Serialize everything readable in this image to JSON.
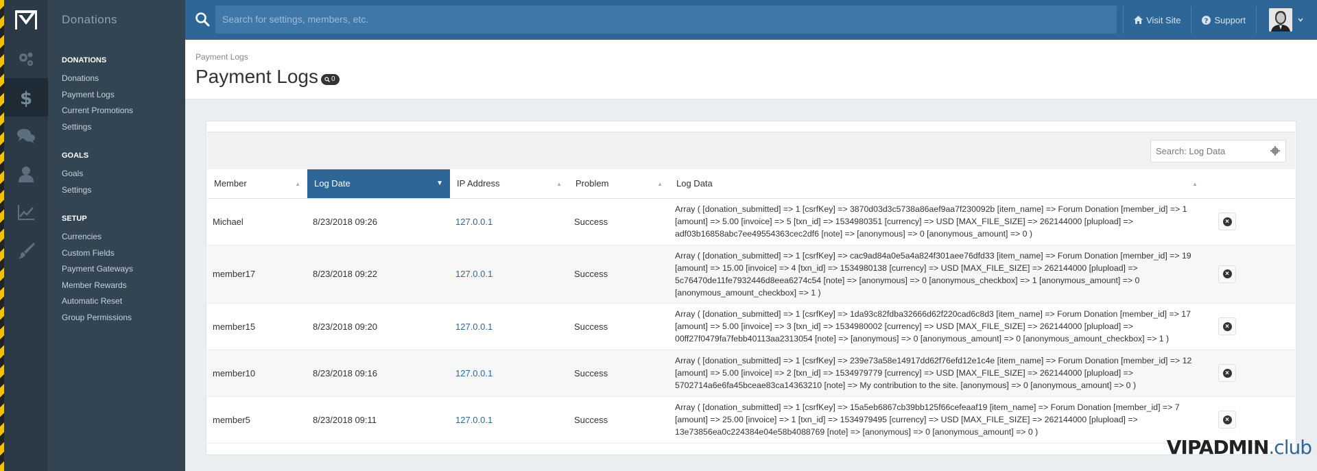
{
  "app": {
    "section_title": "Donations"
  },
  "search": {
    "placeholder": "Search for settings, members, etc."
  },
  "top_links": [
    {
      "label": "Visit Site",
      "icon": "home-icon"
    },
    {
      "label": "Support",
      "icon": "question-circle-icon"
    }
  ],
  "rail": [
    {
      "icon": "gears-icon",
      "active": false
    },
    {
      "icon": "dollar-icon",
      "active": true
    },
    {
      "icon": "chat-bubbles-icon",
      "active": false
    },
    {
      "icon": "user-icon",
      "active": false
    },
    {
      "icon": "line-chart-icon",
      "active": false
    },
    {
      "icon": "paintbrush-icon",
      "active": false
    }
  ],
  "menu": {
    "donations": {
      "heading": "Donations",
      "items": [
        "Donations",
        "Payment Logs",
        "Current Promotions",
        "Settings"
      ]
    },
    "goals": {
      "heading": "Goals",
      "items": [
        "Goals",
        "Settings"
      ]
    },
    "setup": {
      "heading": "Setup",
      "items": [
        "Currencies",
        "Custom Fields",
        "Payment Gateways",
        "Member Rewards",
        "Automatic Reset",
        "Group Permissions"
      ]
    }
  },
  "page": {
    "breadcrumb": "Payment Logs",
    "title": "Payment Logs",
    "badge_count": "0"
  },
  "filter": {
    "placeholder": "Search: Log Data"
  },
  "table": {
    "columns": [
      "Member",
      "Log Date",
      "IP Address",
      "Problem",
      "Log Data"
    ],
    "sorted_column": "Log Date",
    "rows": [
      {
        "member": "Michael",
        "date": "8/23/2018 09:26",
        "ip": "127.0.0.1",
        "problem": "Success",
        "data": "Array ( [donation_submitted] => 1 [csrfKey] => 3870d03d3c5738a86aef9aa7f230092b [item_name] => Forum Donation [member_id] => 1 [amount] => 5.00 [invoice] => 5 [txn_id] => 1534980351 [currency] => USD [MAX_FILE_SIZE] => 262144000 [plupload] => adf03b16858abc7ee49554363cec2df6 [note] => [anonymous] => 0 [anonymous_amount] => 0 )"
      },
      {
        "member": "member17",
        "date": "8/23/2018 09:22",
        "ip": "127.0.0.1",
        "problem": "Success",
        "data": "Array ( [donation_submitted] => 1 [csrfKey] => cac9ad84a0e5a4a824f301aee76dfd33 [item_name] => Forum Donation [member_id] => 19 [amount] => 15.00 [invoice] => 4 [txn_id] => 1534980138 [currency] => USD [MAX_FILE_SIZE] => 262144000 [plupload] => 5c76470de11fe7932446d8eea6274c54 [note] => [anonymous] => 0 [anonymous_checkbox] => 1 [anonymous_amount] => 0 [anonymous_amount_checkbox] => 1 )"
      },
      {
        "member": "member15",
        "date": "8/23/2018 09:20",
        "ip": "127.0.0.1",
        "problem": "Success",
        "data": "Array ( [donation_submitted] => 1 [csrfKey] => 1da93c82fdba32666d62f220cad6c8d3 [item_name] => Forum Donation [member_id] => 17 [amount] => 5.00 [invoice] => 3 [txn_id] => 1534980002 [currency] => USD [MAX_FILE_SIZE] => 262144000 [plupload] => 00ff27f0479fa7febb40113aa2313054 [note] => [anonymous] => 0 [anonymous_amount] => 0 [anonymous_amount_checkbox] => 1 )"
      },
      {
        "member": "member10",
        "date": "8/23/2018 09:16",
        "ip": "127.0.0.1",
        "problem": "Success",
        "data": "Array ( [donation_submitted] => 1 [csrfKey] => 239e73a58e14917dd62f76efd12e1c4e [item_name] => Forum Donation [member_id] => 12 [amount] => 5.00 [invoice] => 2 [txn_id] => 1534979779 [currency] => USD [MAX_FILE_SIZE] => 262144000 [plupload] => 5702714a6e6fa45bceae83ca14363210 [note] => My contribution to the site. [anonymous] => 0 [anonymous_amount] => 0 )"
      },
      {
        "member": "member5",
        "date": "8/23/2018 09:11",
        "ip": "127.0.0.1",
        "problem": "Success",
        "data": "Array ( [donation_submitted] => 1 [csrfKey] => 15a5eb6867cb39bb125f66cefeaaf19 [item_name] => Forum Donation [member_id] => 7 [amount] => 25.00 [invoice] => 1 [txn_id] => 1534979495 [currency] => USD [MAX_FILE_SIZE] => 262144000 [plupload] => 13e73856ea0c224384e04e58b4088769 [note] => [anonymous] => 0 [anonymous_amount] => 0 )"
      }
    ]
  },
  "watermark": {
    "part1": "VIPADMIN",
    "part2": ".club"
  },
  "colors": {
    "accent": "#2e6797",
    "rail": "#2b3a46",
    "submenu": "#334552"
  }
}
